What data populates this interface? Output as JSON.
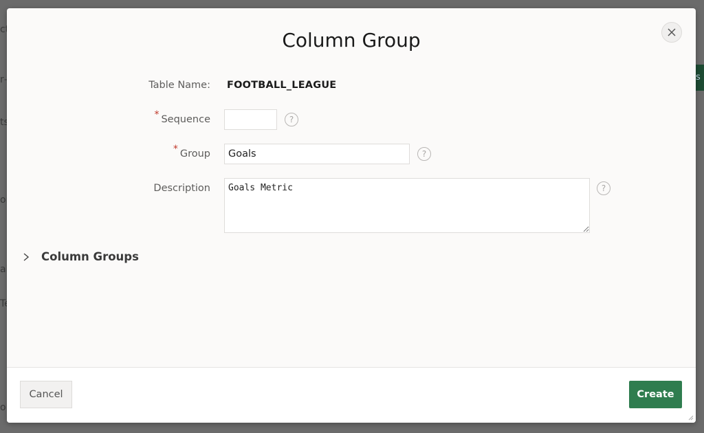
{
  "background": {
    "fragments": [
      "ct",
      "r—",
      "ts",
      "on",
      "ab",
      "Te",
      "ol"
    ],
    "green_button_fragment": "es"
  },
  "dialog": {
    "title": "Column Group",
    "close_label": "×",
    "fields": {
      "table_name": {
        "label": "Table Name:",
        "value": "FOOTBALL_LEAGUE"
      },
      "sequence": {
        "label": "Sequence",
        "required_mark": "*",
        "value": "",
        "help": "?"
      },
      "group": {
        "label": "Group",
        "required_mark": "*",
        "value": "Goals",
        "help": "?"
      },
      "description": {
        "label": "Description",
        "value": "Goals Metric",
        "help": "?"
      }
    },
    "region": {
      "chevron": "›",
      "title": "Column Groups"
    },
    "footer": {
      "cancel_label": "Cancel",
      "create_label": "Create"
    }
  },
  "colors": {
    "primary": "#2f7d4f",
    "required": "#c0392b"
  }
}
